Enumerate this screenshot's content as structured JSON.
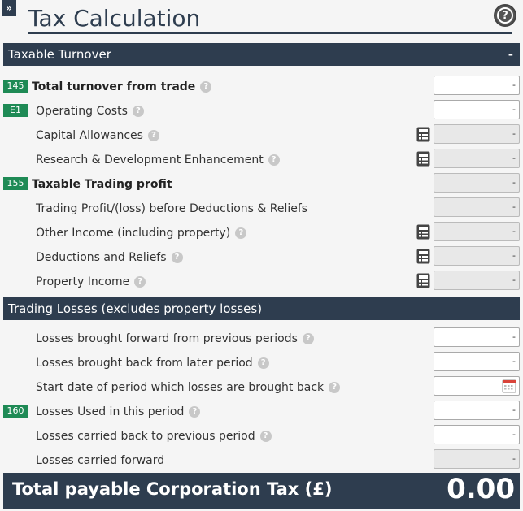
{
  "header": {
    "expand_glyph": "»",
    "title": "Tax Calculation",
    "help_glyph": "?"
  },
  "sections": {
    "turnover": {
      "title": "Taxable Turnover",
      "collapse_glyph": "-"
    },
    "losses": {
      "title": "Trading Losses (excludes property losses)"
    }
  },
  "rows": {
    "total_turnover": {
      "badge": "145",
      "label": "Total turnover from trade",
      "value": "-"
    },
    "operating_costs": {
      "badge": "E1",
      "label": "Operating Costs",
      "value": "-"
    },
    "capital_allowances": {
      "label": "Capital Allowances",
      "value": "-"
    },
    "rd_enhancement": {
      "label": "Research & Development Enhancement",
      "value": "-"
    },
    "taxable_trading_profit": {
      "badge": "155",
      "label": "Taxable Trading profit",
      "value": "-"
    },
    "trading_profit_before": {
      "label": "Trading Profit/(loss) before Deductions & Reliefs",
      "value": "-"
    },
    "other_income": {
      "label": "Other Income (including property)",
      "value": "-"
    },
    "deductions_reliefs": {
      "label": "Deductions and Reliefs",
      "value": "-"
    },
    "property_income": {
      "label": "Property Income",
      "value": "-"
    },
    "losses_bf": {
      "label": "Losses brought forward from previous periods",
      "value": "-"
    },
    "losses_bb": {
      "label": "Losses brought back from later period",
      "value": "-"
    },
    "start_date": {
      "label": "Start date of period which losses are brought back",
      "value": ""
    },
    "losses_used": {
      "badge": "160",
      "label": "Losses Used in this period",
      "value": "-"
    },
    "losses_cb": {
      "label": "Losses carried back to previous period",
      "value": "-"
    },
    "losses_cf": {
      "label": "Losses carried forward",
      "value": "-"
    }
  },
  "total": {
    "label": "Total payable Corporation Tax (£)",
    "value": "0.00"
  },
  "icons": {
    "help": "question-circle",
    "calculator": "calculator",
    "calendar": "calendar"
  },
  "colors": {
    "header_bg": "#2e3d4f",
    "badge_bg": "#1e8a55"
  }
}
